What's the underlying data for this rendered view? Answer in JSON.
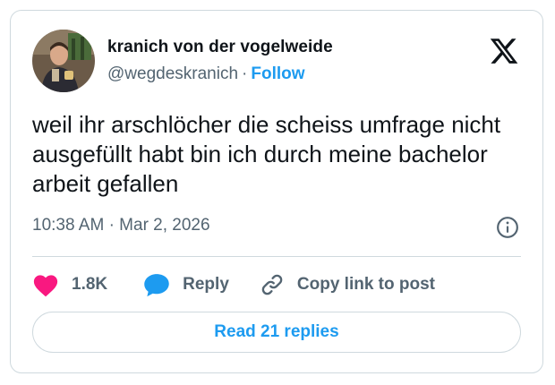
{
  "author": {
    "display_name": "kranich von der vogelweide",
    "handle": "@wegdeskranich",
    "separator": "·",
    "follow_label": "Follow"
  },
  "tweet": {
    "text": "weil ihr arschlöcher die scheiss umfrage nicht ausgefüllt habt bin ich durch meine bachelor arbeit gefallen",
    "time": "10:38 AM",
    "meta_separator": "·",
    "date": "Mar 2, 2026"
  },
  "actions": {
    "like_count": "1.8K",
    "reply_label": "Reply",
    "copy_label": "Copy link to post"
  },
  "read_replies_label": "Read 21 replies",
  "icons": {
    "logo": "x-logo-icon",
    "info": "info-icon",
    "like": "heart-icon",
    "reply": "speech-bubble-icon",
    "copy": "link-icon"
  },
  "colors": {
    "accent": "#1d9bf0",
    "like": "#f91880",
    "secondary_text": "#536471",
    "primary_text": "#0f1419",
    "border": "#cfd9de"
  }
}
